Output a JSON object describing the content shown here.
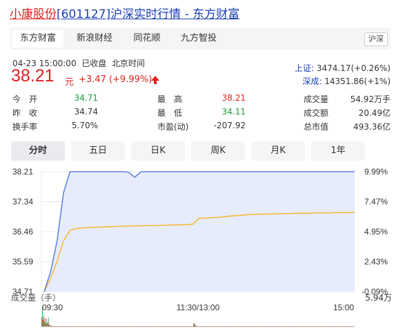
{
  "title": {
    "stock_name": "小康股份",
    "code_bracket": "[601127]",
    "suffix": "沪深实时行情",
    "sep": " - ",
    "source": "东方财富"
  },
  "source_tabs": [
    "东方财富",
    "新浪财经",
    "同花顺",
    "九方智投"
  ],
  "market_badge": "沪深",
  "meta": {
    "date_time": "04-23 15:00:00",
    "status": "已收盘",
    "timezone": "北京时间"
  },
  "price": {
    "value": "38.21",
    "unit": "元",
    "change": "+3.47 (+9.99%)",
    "arrow_icon": "up-arrow-icon"
  },
  "indices": [
    {
      "name": "上证:",
      "value": "3474.17(+0.26%)"
    },
    {
      "name": "深成:",
      "value": "14351.86(+1%)"
    }
  ],
  "quote": {
    "open": {
      "label": "今　开",
      "value": "34.71"
    },
    "prev_close": {
      "label": "昨　收",
      "value": "34.74"
    },
    "turnover_rate": {
      "label": "换手率",
      "value": "5.70%"
    },
    "high": {
      "label": "最　高",
      "value": "38.21"
    },
    "low": {
      "label": "最　低",
      "value": "34.11"
    },
    "pe": {
      "label": "市盈(动)",
      "value": "-207.92"
    },
    "volume": {
      "label": "成交量",
      "value": "54.92万手"
    },
    "amount": {
      "label": "成交额",
      "value": "20.49亿"
    },
    "market_cap": {
      "label": "总市值",
      "value": "493.36亿"
    }
  },
  "period_tabs": [
    "分时",
    "五日",
    "日K",
    "周K",
    "月K",
    "1年"
  ],
  "colors": {
    "up": "#e02020",
    "down": "#1a9c3a",
    "price_line": "#5b7fe0",
    "avg_line": "#f5b731",
    "area_fill": "#e6ecfb"
  },
  "chart_data": {
    "type": "line",
    "y_price_ticks": [
      "38.21",
      "37.34",
      "36.46",
      "35.59",
      "34.71"
    ],
    "y_pct_ticks": [
      "9.99%",
      "7.47%",
      "4.95%",
      "2.43%",
      "-0.09%"
    ],
    "ylim": [
      34.71,
      38.21
    ],
    "x_ticks": [
      "09:30",
      "11:30/13:00",
      "15:00"
    ],
    "series": [
      {
        "values": [
          34.71,
          35.3,
          36.2,
          37.6,
          38.21,
          38.21,
          38.21,
          38.21,
          38.21,
          38.21,
          38.21,
          38.21,
          38.21,
          38.2,
          38.05,
          38.21,
          38.21,
          38.21,
          38.21,
          38.21,
          38.21,
          38.21,
          38.21,
          38.21,
          38.21,
          38.21,
          38.21,
          38.21,
          38.21,
          38.21,
          38.21,
          38.21,
          38.21,
          38.21,
          38.21,
          38.21,
          38.21,
          38.21,
          38.21,
          38.21,
          38.21,
          38.21,
          38.21,
          38.21,
          38.21,
          38.21,
          38.21,
          38.21,
          38.21
        ]
      },
      {
        "values": [
          34.71,
          35.1,
          35.6,
          36.2,
          36.5,
          36.55,
          36.57,
          36.58,
          36.59,
          36.6,
          36.6,
          36.61,
          36.62,
          36.62,
          36.63,
          36.63,
          36.64,
          36.64,
          36.65,
          36.65,
          36.66,
          36.66,
          36.67,
          36.68,
          36.85,
          36.86,
          36.87,
          36.88,
          36.9,
          36.92,
          36.93,
          36.95,
          36.96,
          36.97,
          36.97,
          36.98,
          36.98,
          36.99,
          36.99,
          37.0,
          37.0,
          37.0,
          37.01,
          37.01,
          37.01,
          37.02,
          37.02,
          37.02,
          37.02
        ]
      }
    ],
    "volume_title": "成交量（手）",
    "volume_max_label": "5.94万",
    "volume": [
      2.8,
      5.94,
      2.1,
      3.2,
      1.5,
      2.5,
      1.0,
      2.3,
      0.9,
      1.4,
      2.7,
      0.7,
      0.5,
      0.3,
      0.4,
      0.2,
      0.3,
      0.2,
      0.15,
      0.1,
      0.1,
      0.1,
      0.05,
      0.05,
      0.05,
      0.05,
      0.05,
      0.05,
      0.05,
      0.05,
      0.05,
      0.05,
      0.05,
      0.05,
      0.05,
      0.05,
      0.05,
      0.05,
      0.05,
      0.05,
      0.05,
      0.05,
      0.05,
      0.05,
      0.05,
      0.05,
      0.05,
      0.05,
      0.05,
      0.05,
      0.05,
      0.05,
      0.05,
      0.05,
      0.05,
      0.05,
      0.05,
      0.05,
      0.05,
      0.05,
      0.05,
      0.05,
      0.05,
      0.05,
      0.05,
      0.05,
      0.05,
      0.05,
      0.05,
      0.05,
      0.05,
      0.05,
      0.05,
      0.05,
      0.05,
      0.05,
      0.05,
      0.05,
      0.05,
      0.05,
      0.05,
      0.05,
      0.05,
      0.05,
      0.05,
      0.05,
      0.05,
      0.05,
      0.05,
      0.05,
      0.05,
      0.05,
      0.05,
      0.05,
      0.05,
      0.05,
      0.05,
      0.05,
      0.05,
      0.05,
      0.05,
      0.05,
      0.05,
      0.05,
      0.05,
      0.05,
      0.05,
      0.05,
      0.05,
      0.05,
      0.05,
      0.05,
      0.05,
      0.05,
      0.05,
      0.05,
      0.05,
      0.05,
      0.05,
      0.05,
      0.05,
      0.05,
      0.05,
      0.05,
      0.05,
      0.05,
      0.05,
      0.05,
      0.05,
      0.05,
      0.05,
      0.05,
      0.05,
      0.05,
      0.05,
      0.05,
      0.05,
      0.05,
      0.05,
      0.05,
      0.05,
      0.05,
      0.05,
      0.05,
      0.05,
      0.05,
      0.05,
      0.05,
      0.05,
      0.05,
      0.05,
      0.05,
      0.05,
      0.05,
      0.05,
      0.05,
      0.05,
      0.05,
      0.05,
      0.05,
      0.05,
      0.05,
      0.05,
      0.05,
      0.05,
      0.05,
      0.05,
      0.05,
      0.05,
      0.05,
      0.05,
      0.05,
      0.05,
      0.05,
      0.05,
      0.05,
      0.05,
      0.05,
      0.05,
      0.05,
      0.05,
      0.05,
      0.05,
      0.05,
      0.05,
      0.05,
      0.05,
      0.05,
      0.05,
      0.05,
      0.05,
      0.05,
      0.05,
      0.05,
      0.05,
      0.05,
      0.05,
      0.05,
      0.05,
      0.05,
      0.05,
      0.05,
      0.05,
      0.05,
      0.05,
      0.05,
      0.05,
      0.05,
      0.05,
      0.05,
      0.05,
      0.05,
      0.05,
      0.05,
      0.05,
      0.05,
      0.05,
      0.05,
      0.05,
      0.05,
      0.05,
      0.05,
      0.05,
      0.05,
      0.05,
      0.05,
      0.9,
      1.1,
      0.6,
      0.4,
      0.3,
      0.2,
      0.1,
      0.1,
      0.1,
      0.05,
      0.05,
      0.05,
      0.05,
      0.05,
      0.05,
      0.05,
      0.05,
      0.05,
      0.05,
      0.05,
      0.05,
      0.05,
      0.05,
      0.05,
      0.05,
      0.05,
      0.05,
      0.05,
      0.05,
      0.05,
      0.05,
      0.05,
      0.05,
      0.05,
      0.05,
      0.05,
      0.05,
      0.05,
      0.05,
      0.05,
      0.05,
      0.05,
      0.05,
      0.05,
      0.05,
      0.05,
      0.05,
      0.05,
      0.05,
      0.05,
      0.05,
      0.05,
      0.05,
      0.05,
      0.05,
      0.05,
      0.05,
      0.05,
      0.05,
      0.05,
      0.05,
      0.05,
      0.05,
      0.05,
      0.05,
      0.05,
      0.05,
      0.05,
      0.05,
      0.05,
      0.05,
      0.05,
      0.05,
      0.05,
      0.05,
      0.05,
      0.05,
      0.05,
      0.05,
      0.05,
      0.05,
      0.05,
      0.05,
      0.05,
      0.05,
      0.05,
      0.05,
      0.05,
      0.05,
      0.05,
      0.05,
      0.05,
      0.05,
      0.05,
      0.05,
      0.05,
      0.05,
      0.05,
      0.05,
      0.05,
      0.05,
      0.05,
      0.05,
      0.05,
      0.05,
      0.05,
      0.05,
      0.05,
      0.05,
      0.05,
      0.05,
      0.05,
      0.05,
      0.05,
      0.05,
      0.05,
      0.05,
      0.05,
      0.05,
      0.05,
      0.05,
      0.05,
      0.05,
      0.05,
      0.05,
      0.05,
      0.05,
      0.05,
      0.05,
      0.05,
      0.05,
      0.05,
      0.05,
      0.05,
      0.05,
      0.05,
      0.05,
      0.05,
      0.05,
      0.05,
      0.05,
      0.05,
      0.05,
      0.05,
      0.05,
      0.05,
      0.05,
      0.05,
      0.05,
      0.05,
      0.05,
      0.05,
      0.05,
      0.05,
      0.05,
      0.05,
      0.05,
      0.05,
      0.05,
      0.05,
      0.05,
      0.05,
      0.05,
      0.05,
      0.05,
      0.05,
      0.05,
      0.05,
      0.05,
      0.05,
      0.05,
      0.05,
      0.05,
      0.05,
      0.05,
      0.05,
      0.05,
      0.05,
      0.05,
      0.05,
      0.05,
      0.05,
      0.05,
      0.05,
      0.05,
      0.05,
      0.05,
      0.05,
      0.05,
      0.05,
      0.05,
      0.05,
      0.05,
      0.05,
      0.05,
      0.05,
      0.05,
      0.05,
      0.05,
      0.05,
      0.05,
      0.05,
      0.05,
      0.05,
      0.05,
      0.05,
      0.05,
      0.05,
      0.05,
      0.05,
      0.05,
      0.05,
      0.05,
      0.05,
      0.05,
      0.05,
      0.05,
      0.05,
      0.05,
      0.05,
      0.05,
      0.05,
      0.05,
      0.05,
      0.05,
      0.05,
      0.05,
      0.05,
      0.05,
      0.05,
      0.05,
      0.05,
      0.05,
      0.05,
      0.05,
      0.05,
      0.05,
      0.05,
      0.05,
      0.05
    ]
  }
}
